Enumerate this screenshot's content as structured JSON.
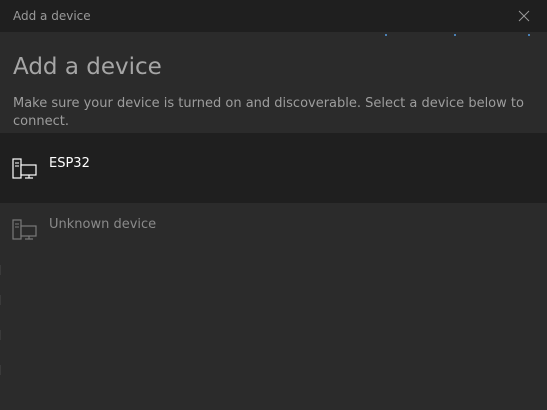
{
  "window": {
    "title": "Add a device"
  },
  "dialog": {
    "heading": "Add a device",
    "instructions": "Make sure your device is turned on and discoverable. Select a device below to connect."
  },
  "devices": [
    {
      "label": "ESP32",
      "icon": "computer-device-icon",
      "state": "selected"
    },
    {
      "label": "Unknown device",
      "icon": "computer-device-icon",
      "state": "disabled"
    }
  ],
  "colors": {
    "background": "#2b2b2b",
    "titlebar": "#1f1f1f",
    "selected_row": "#1f1f1f",
    "accent": "#4a7fb3"
  }
}
